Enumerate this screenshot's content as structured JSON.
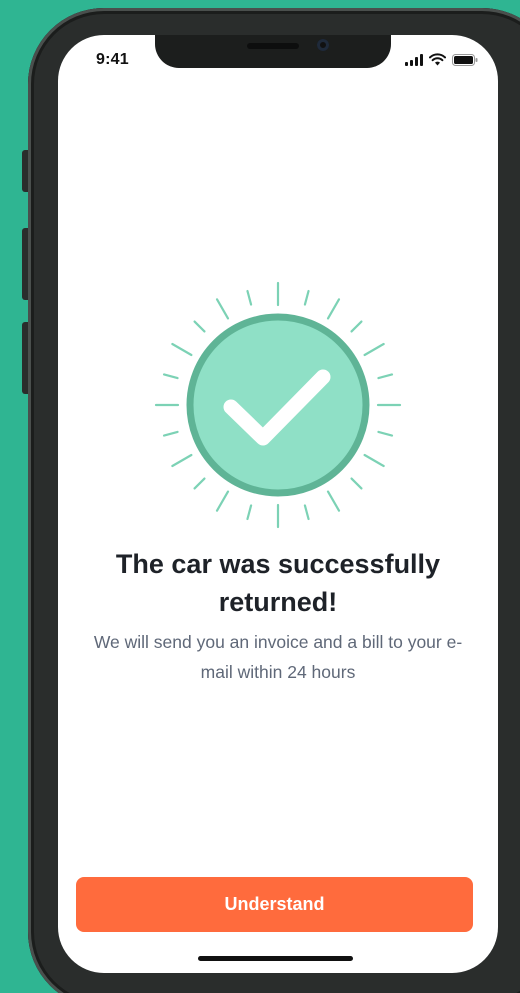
{
  "status_bar": {
    "time": "9:41",
    "icons": [
      "signal-icon",
      "wifi-icon",
      "battery-icon"
    ]
  },
  "illustration": {
    "icon": "checkmark-sunburst-icon",
    "colors": {
      "circle_fill": "#8fe0c6",
      "circle_border": "#5fb496",
      "rays": "#7cd2b5",
      "check": "#ffffff"
    }
  },
  "message": {
    "title": "The car was successfully returned!",
    "subtitle": "We will send you an invoice and a bill to your e-mail within 24 hours"
  },
  "actions": {
    "understand_label": "Understand",
    "accent_color": "#ff6b3d"
  },
  "background_color": "#2fb592"
}
